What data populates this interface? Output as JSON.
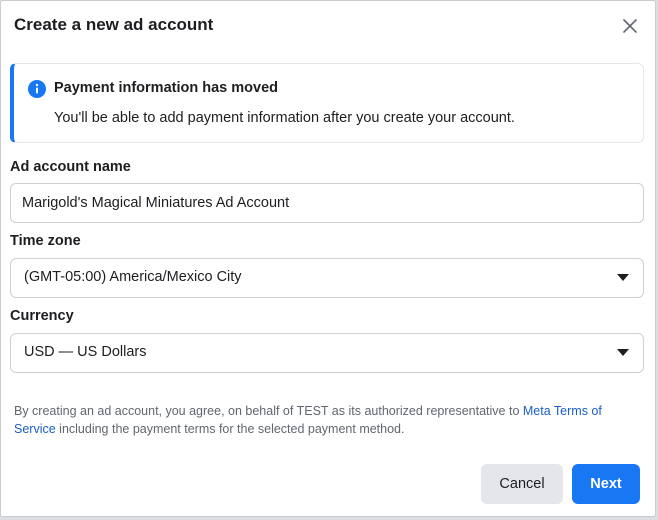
{
  "dialog": {
    "title": "Create a new ad account",
    "close_icon": "close-icon"
  },
  "banner": {
    "icon": "info-icon",
    "title": "Payment information has moved",
    "body": "You'll be able to add payment information after you create your account."
  },
  "form": {
    "account_name": {
      "label": "Ad account name",
      "value": "Marigold's Magical Miniatures Ad Account"
    },
    "time_zone": {
      "label": "Time zone",
      "selected": "(GMT-05:00) America/Mexico City"
    },
    "currency": {
      "label": "Currency",
      "selected": "USD — US Dollars"
    }
  },
  "terms": {
    "prefix": "By creating an ad account, you agree, on behalf of TEST as its authorized representative to ",
    "link": "Meta Terms of Service",
    "suffix": " including the payment terms for the selected payment method."
  },
  "buttons": {
    "cancel": "Cancel",
    "next": "Next"
  },
  "colors": {
    "accent": "#1877f2",
    "link": "#1a5ec8",
    "text": "#1c1e21",
    "muted": "#606770"
  }
}
